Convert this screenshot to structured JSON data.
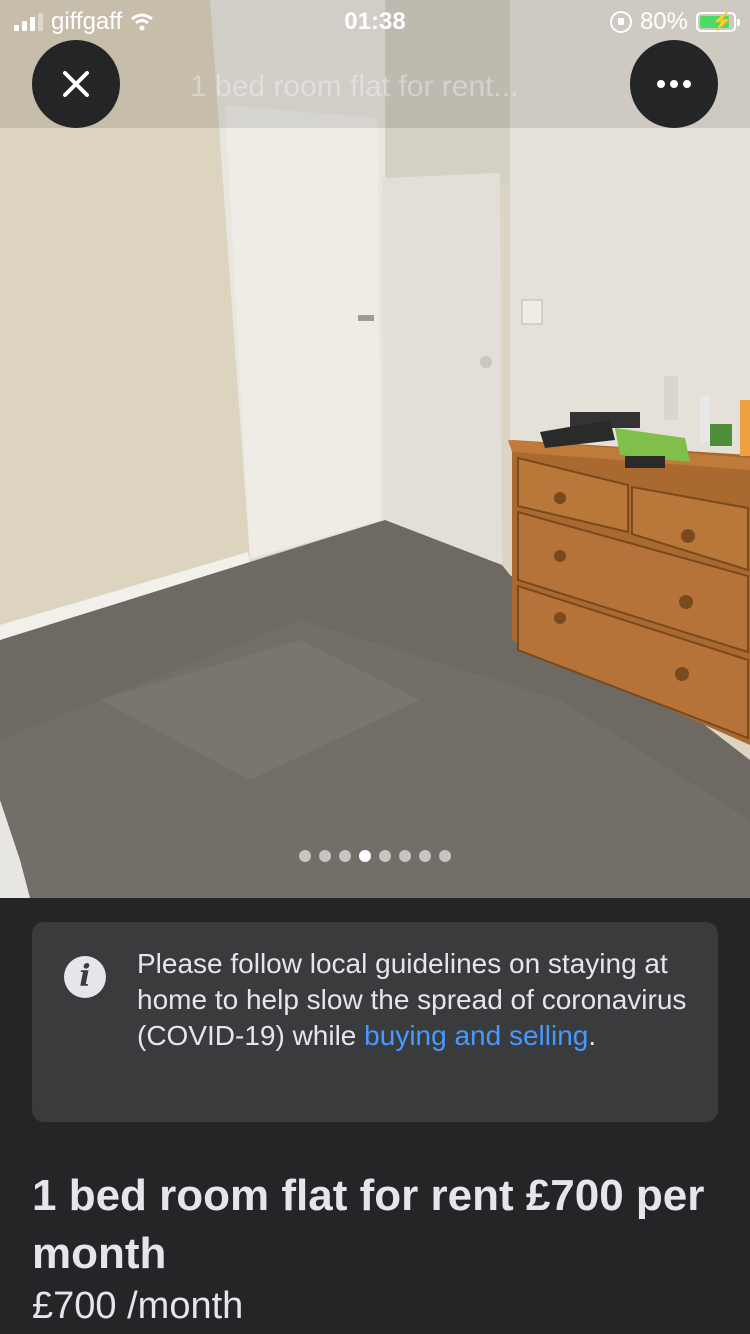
{
  "status_bar": {
    "carrier": "giffgaff",
    "time": "01:38",
    "battery": "80%"
  },
  "header": {
    "title": "1 bed room flat for rent...",
    "close_icon": "close-icon",
    "more_icon": "more-horizontal-icon"
  },
  "photo_carousel": {
    "total": 8,
    "current": 4,
    "description_icon": "room-photo"
  },
  "notice": {
    "icon": "info-icon",
    "text": "Please follow local guidelines on staying at home to help slow the spread of coronavirus (COVID-19) while ",
    "link": "buying and selling",
    "after": "."
  },
  "listing": {
    "title": "1 bed room flat for rent £700 per month",
    "price": "£700",
    "period": "/month"
  },
  "colors": {
    "background": "#242526",
    "card": "#3a3b3c",
    "link": "#4599ff",
    "text": "#e4e6eb"
  }
}
